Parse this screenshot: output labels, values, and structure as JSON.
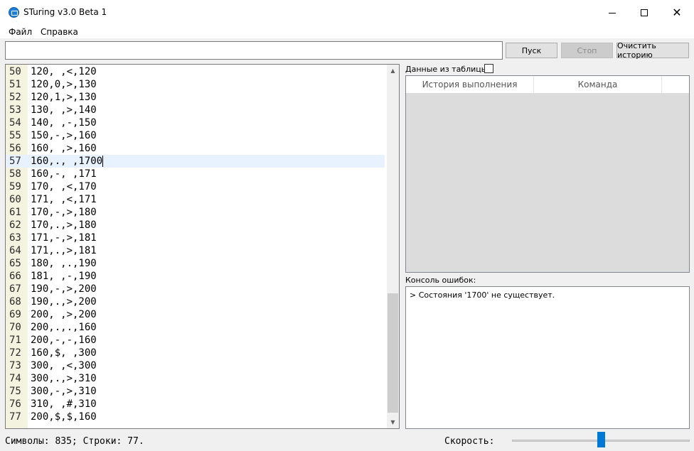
{
  "window": {
    "title": "STuring v3.0 Beta 1"
  },
  "menu": {
    "file": "Файл",
    "help": "Справка"
  },
  "toolbar": {
    "command_value": "",
    "run_label": "Пуск",
    "stop_label": "Стоп",
    "clear_label": "Очистить историю"
  },
  "editor": {
    "current_line": 57,
    "lines": [
      {
        "n": "50",
        "text": "120, ,<,120"
      },
      {
        "n": "51",
        "text": "120,0,>,130"
      },
      {
        "n": "52",
        "text": "120,1,>,130"
      },
      {
        "n": "53",
        "text": "130, ,>,140"
      },
      {
        "n": "54",
        "text": "140, ,-,150"
      },
      {
        "n": "55",
        "text": "150,-,>,160"
      },
      {
        "n": "56",
        "text": "160, ,>,160"
      },
      {
        "n": "57",
        "text": "160,., ,1700"
      },
      {
        "n": "58",
        "text": "160,-, ,171"
      },
      {
        "n": "59",
        "text": "170, ,<,170"
      },
      {
        "n": "60",
        "text": "171, ,<,171"
      },
      {
        "n": "61",
        "text": "170,-,>,180"
      },
      {
        "n": "62",
        "text": "170,.,>,180"
      },
      {
        "n": "63",
        "text": "171,-,>,181"
      },
      {
        "n": "64",
        "text": "171,.,>,181"
      },
      {
        "n": "65",
        "text": "180, ,.,190"
      },
      {
        "n": "66",
        "text": "181, ,-,190"
      },
      {
        "n": "67",
        "text": "190,-,>,200"
      },
      {
        "n": "68",
        "text": "190,.,>,200"
      },
      {
        "n": "69",
        "text": "200, ,>,200"
      },
      {
        "n": "70",
        "text": "200,.,.,160"
      },
      {
        "n": "71",
        "text": "200,-,-,160"
      },
      {
        "n": "72",
        "text": "160,$, ,300"
      },
      {
        "n": "73",
        "text": "300, ,<,300"
      },
      {
        "n": "74",
        "text": "300,.,>,310"
      },
      {
        "n": "75",
        "text": "300,-,>,310"
      },
      {
        "n": "76",
        "text": "310, ,#,310"
      },
      {
        "n": "77",
        "text": "200,$,$,160"
      }
    ]
  },
  "table": {
    "label": "Данные из таблицы:",
    "checked": false,
    "columns": [
      "История выполнения",
      "Команда"
    ]
  },
  "console": {
    "label": "Консоль ошибок:",
    "message": "> Состояния '1700' не существует."
  },
  "status": {
    "summary": "Символы: 835; Строки: 77.",
    "speed_label": "Скорость:",
    "speed_value": 0.5
  },
  "colors": {
    "accent": "#0078d7",
    "gutter": "#f3f3df",
    "current_line": "#e8f2fe"
  }
}
